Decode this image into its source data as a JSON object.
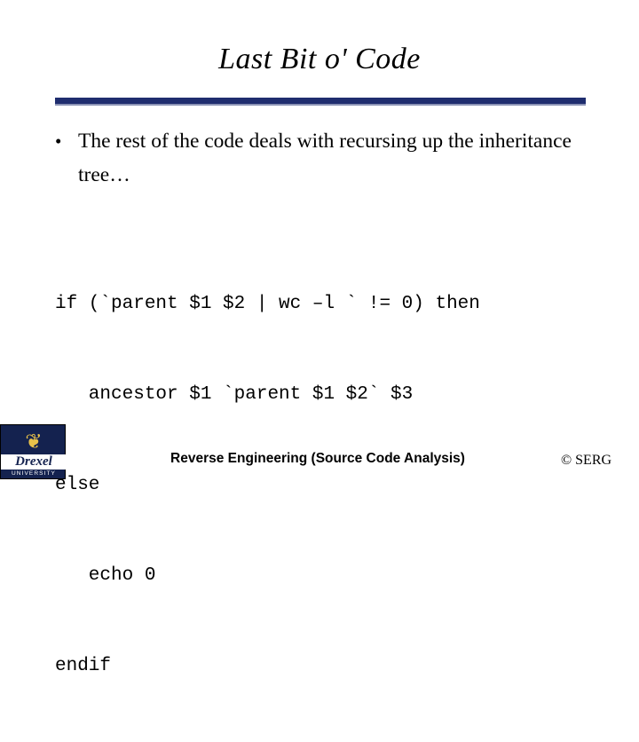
{
  "slide": {
    "title": "Last Bit o' Code",
    "bullet": {
      "marker": "•",
      "text": "The rest of the code deals with recursing up the inheritance tree…"
    },
    "code_lines": [
      "if (`parent $1 $2 | wc –l ` != 0) then",
      "   ancestor $1 `parent $1 $2` $3",
      "else",
      "   echo 0",
      "endif"
    ],
    "footer": "Reverse Engineering (Source Code Analysis)",
    "copyright": "© SERG",
    "logo": {
      "crest": "❦",
      "name": "Drexel",
      "sub": "UNIVERSITY"
    },
    "colors": {
      "rule": "#1f2d6e",
      "rule_shadow": "#8c93b5",
      "logo_bg": "#14224f",
      "logo_gold": "#e8c14a"
    }
  }
}
